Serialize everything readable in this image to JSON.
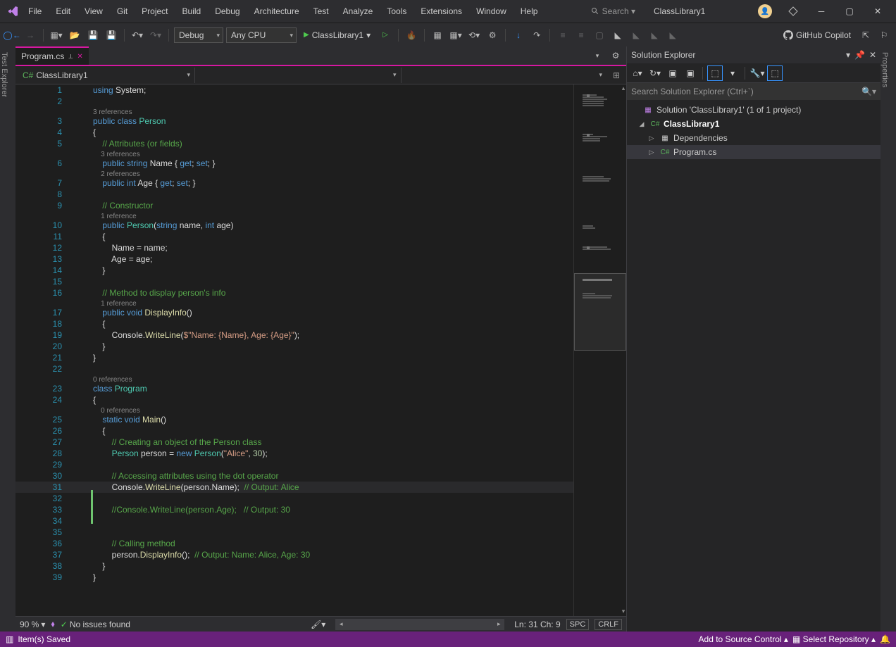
{
  "menu": [
    "File",
    "Edit",
    "View",
    "Git",
    "Project",
    "Build",
    "Debug",
    "Architecture",
    "Test",
    "Analyze",
    "Tools",
    "Extensions",
    "Window",
    "Help"
  ],
  "search_placeholder": "Search ▾",
  "project_name": "ClassLibrary1",
  "toolbar": {
    "config": "Debug",
    "platform": "Any CPU",
    "start_target": "ClassLibrary1",
    "copilot": "GitHub Copilot"
  },
  "left_strip": "Test Explorer",
  "right_strip": "Properties",
  "tab": {
    "name": "Program.cs"
  },
  "nav": {
    "project": "ClassLibrary1"
  },
  "code": [
    {
      "n": "1",
      "t": [
        [
          "kw",
          "using"
        ],
        [
          "",
          " System;"
        ]
      ]
    },
    {
      "n": "2",
      "t": [
        [
          "",
          ""
        ]
      ]
    },
    {
      "lens": "3 references"
    },
    {
      "n": "3",
      "t": [
        [
          "kw",
          "public class "
        ],
        [
          "type",
          "Person"
        ]
      ]
    },
    {
      "n": "4",
      "t": [
        [
          "",
          "{"
        ]
      ]
    },
    {
      "n": "5",
      "t": [
        [
          "",
          "    "
        ],
        [
          "com",
          "// Attributes (or fields)"
        ]
      ]
    },
    {
      "lens": "3 references",
      "indent": "    "
    },
    {
      "n": "6",
      "t": [
        [
          "",
          "    "
        ],
        [
          "kw",
          "public string"
        ],
        [
          "",
          " Name { "
        ],
        [
          "kw",
          "get"
        ],
        [
          "",
          "; "
        ],
        [
          "kw",
          "set"
        ],
        [
          "",
          "; }"
        ]
      ]
    },
    {
      "lens": "2 references",
      "indent": "    "
    },
    {
      "n": "7",
      "t": [
        [
          "",
          "    "
        ],
        [
          "kw",
          "public int"
        ],
        [
          "",
          " Age { "
        ],
        [
          "kw",
          "get"
        ],
        [
          "",
          "; "
        ],
        [
          "kw",
          "set"
        ],
        [
          "",
          "; }"
        ]
      ]
    },
    {
      "n": "8",
      "t": [
        [
          "",
          ""
        ]
      ]
    },
    {
      "n": "9",
      "t": [
        [
          "",
          "    "
        ],
        [
          "com",
          "// Constructor"
        ]
      ]
    },
    {
      "lens": "1 reference",
      "indent": "    "
    },
    {
      "n": "10",
      "t": [
        [
          "",
          "    "
        ],
        [
          "kw",
          "public "
        ],
        [
          "type",
          "Person"
        ],
        [
          "",
          "("
        ],
        [
          "kw",
          "string"
        ],
        [
          "",
          " name, "
        ],
        [
          "kw",
          "int"
        ],
        [
          "",
          " age)"
        ]
      ]
    },
    {
      "n": "11",
      "t": [
        [
          "",
          "    {"
        ]
      ]
    },
    {
      "n": "12",
      "t": [
        [
          "",
          "        Name = name;"
        ]
      ]
    },
    {
      "n": "13",
      "t": [
        [
          "",
          "        Age = age;"
        ]
      ]
    },
    {
      "n": "14",
      "t": [
        [
          "",
          "    }"
        ]
      ]
    },
    {
      "n": "15",
      "t": [
        [
          "",
          ""
        ]
      ]
    },
    {
      "n": "16",
      "t": [
        [
          "",
          "    "
        ],
        [
          "com",
          "// Method to display person's info"
        ]
      ]
    },
    {
      "lens": "1 reference",
      "indent": "    "
    },
    {
      "n": "17",
      "t": [
        [
          "",
          "    "
        ],
        [
          "kw",
          "public void "
        ],
        [
          "meth",
          "DisplayInfo"
        ],
        [
          "",
          "()"
        ]
      ]
    },
    {
      "n": "18",
      "t": [
        [
          "",
          "    {"
        ]
      ]
    },
    {
      "n": "19",
      "t": [
        [
          "",
          "        Console."
        ],
        [
          "meth",
          "WriteLine"
        ],
        [
          "",
          "("
        ],
        [
          "str",
          "$\"Name: {Name}, Age: {Age}\""
        ],
        [
          "",
          ");"
        ]
      ]
    },
    {
      "n": "20",
      "t": [
        [
          "",
          "    }"
        ]
      ]
    },
    {
      "n": "21",
      "t": [
        [
          "",
          "}"
        ]
      ]
    },
    {
      "n": "22",
      "t": [
        [
          "",
          ""
        ]
      ]
    },
    {
      "lens": "0 references"
    },
    {
      "n": "23",
      "t": [
        [
          "kw",
          "class "
        ],
        [
          "type",
          "Program"
        ]
      ]
    },
    {
      "n": "24",
      "t": [
        [
          "",
          "{"
        ]
      ]
    },
    {
      "lens": "0 references",
      "indent": "    "
    },
    {
      "n": "25",
      "t": [
        [
          "",
          "    "
        ],
        [
          "kw",
          "static void "
        ],
        [
          "meth",
          "Main"
        ],
        [
          "",
          "()"
        ]
      ]
    },
    {
      "n": "26",
      "t": [
        [
          "",
          "    {"
        ]
      ]
    },
    {
      "n": "27",
      "t": [
        [
          "",
          "        "
        ],
        [
          "com",
          "// Creating an object of the Person class"
        ]
      ]
    },
    {
      "n": "28",
      "t": [
        [
          "",
          "        "
        ],
        [
          "type",
          "Person"
        ],
        [
          "",
          " person = "
        ],
        [
          "kw",
          "new "
        ],
        [
          "type",
          "Person"
        ],
        [
          "",
          "("
        ],
        [
          "str",
          "\"Alice\""
        ],
        [
          "",
          ", "
        ],
        [
          "num",
          "30"
        ],
        [
          "",
          ");"
        ]
      ]
    },
    {
      "n": "29",
      "t": [
        [
          "",
          ""
        ]
      ]
    },
    {
      "n": "30",
      "t": [
        [
          "",
          "        "
        ],
        [
          "com",
          "// Accessing attributes using the dot operator"
        ]
      ]
    },
    {
      "n": "31",
      "hl": true,
      "t": [
        [
          "",
          "        Console."
        ],
        [
          "meth",
          "WriteLine"
        ],
        [
          "",
          "(person.Name);  "
        ],
        [
          "com",
          "// Output: Alice"
        ]
      ]
    },
    {
      "n": "32",
      "t": [
        [
          "",
          ""
        ]
      ],
      "cb": true
    },
    {
      "n": "33",
      "t": [
        [
          "",
          "        "
        ],
        [
          "com",
          "//Console.WriteLine(person.Age);   // Output: 30"
        ]
      ],
      "cb": true
    },
    {
      "n": "34",
      "t": [
        [
          "",
          ""
        ]
      ],
      "cb": true
    },
    {
      "n": "35",
      "t": [
        [
          "",
          ""
        ]
      ]
    },
    {
      "n": "36",
      "t": [
        [
          "",
          "        "
        ],
        [
          "com",
          "// Calling method"
        ]
      ]
    },
    {
      "n": "37",
      "t": [
        [
          "",
          "        person."
        ],
        [
          "meth",
          "DisplayInfo"
        ],
        [
          "",
          "();  "
        ],
        [
          "com",
          "// Output: Name: Alice, Age: 30"
        ]
      ]
    },
    {
      "n": "38",
      "t": [
        [
          "",
          "    }"
        ]
      ]
    },
    {
      "n": "39",
      "t": [
        [
          "",
          "}"
        ]
      ]
    }
  ],
  "status": {
    "zoom": "90 %",
    "issues": "No issues found",
    "cursor": "Ln: 31    Ch: 9",
    "insert": "SPC",
    "eol": "CRLF"
  },
  "solution": {
    "title": "Solution Explorer",
    "search_placeholder": "Search Solution Explorer (Ctrl+`)",
    "root": "Solution 'ClassLibrary1' (1 of 1 project)",
    "project": "ClassLibrary1",
    "deps": "Dependencies",
    "file": "Program.cs"
  },
  "appbar": {
    "status": "Item(s) Saved",
    "source_control": "Add to Source Control ▴",
    "repo": "Select Repository ▴"
  }
}
